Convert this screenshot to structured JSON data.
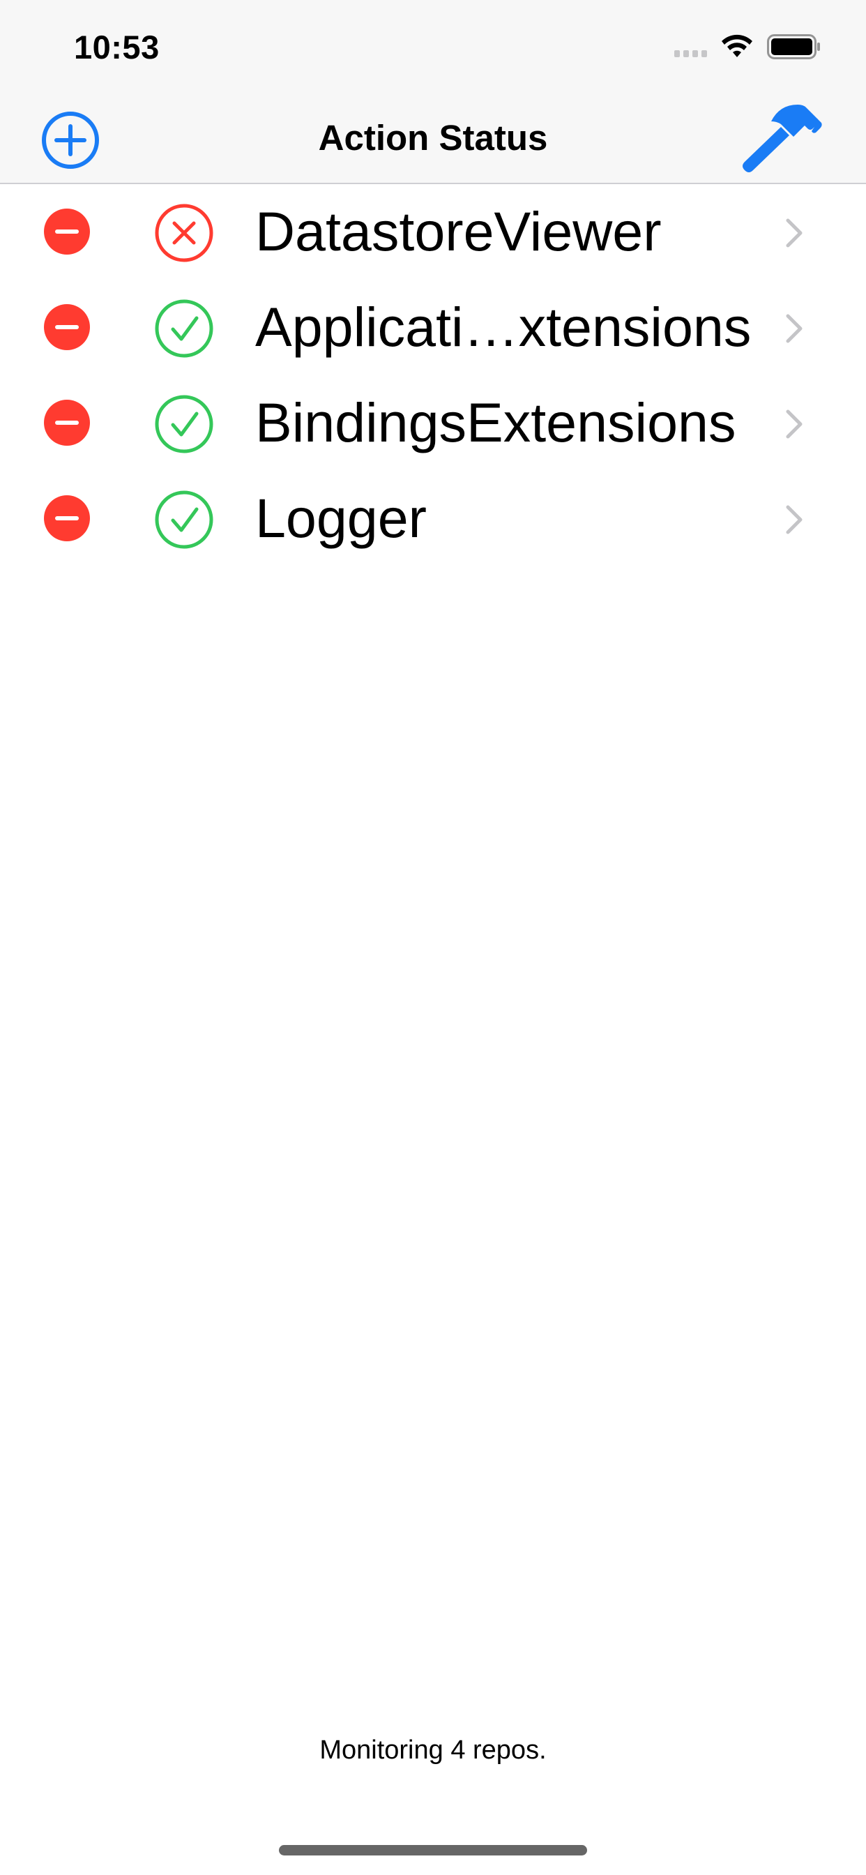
{
  "status_bar": {
    "time": "10:53",
    "icons": [
      "cellular-signal-icon",
      "wifi-icon",
      "battery-icon"
    ]
  },
  "nav": {
    "title": "Action Status",
    "left_button_icon": "plus-circle-icon",
    "right_button_icon": "hammer-icon"
  },
  "colors": {
    "accent": "#1a7cf5",
    "delete": "#ff3b30",
    "failure": "#ff3b30",
    "success": "#34c759",
    "chevron": "#c4c4c7"
  },
  "repos": [
    {
      "name": "DatastoreViewer",
      "status": "failure",
      "status_icon": "x-circle-icon"
    },
    {
      "name": "Applicati…xtensions",
      "status": "success",
      "status_icon": "checkmark-circle-icon"
    },
    {
      "name": "BindingsExtensions",
      "status": "success",
      "status_icon": "checkmark-circle-icon"
    },
    {
      "name": "Logger",
      "status": "success",
      "status_icon": "checkmark-circle-icon"
    }
  ],
  "footer": {
    "text": "Monitoring 4 repos."
  }
}
